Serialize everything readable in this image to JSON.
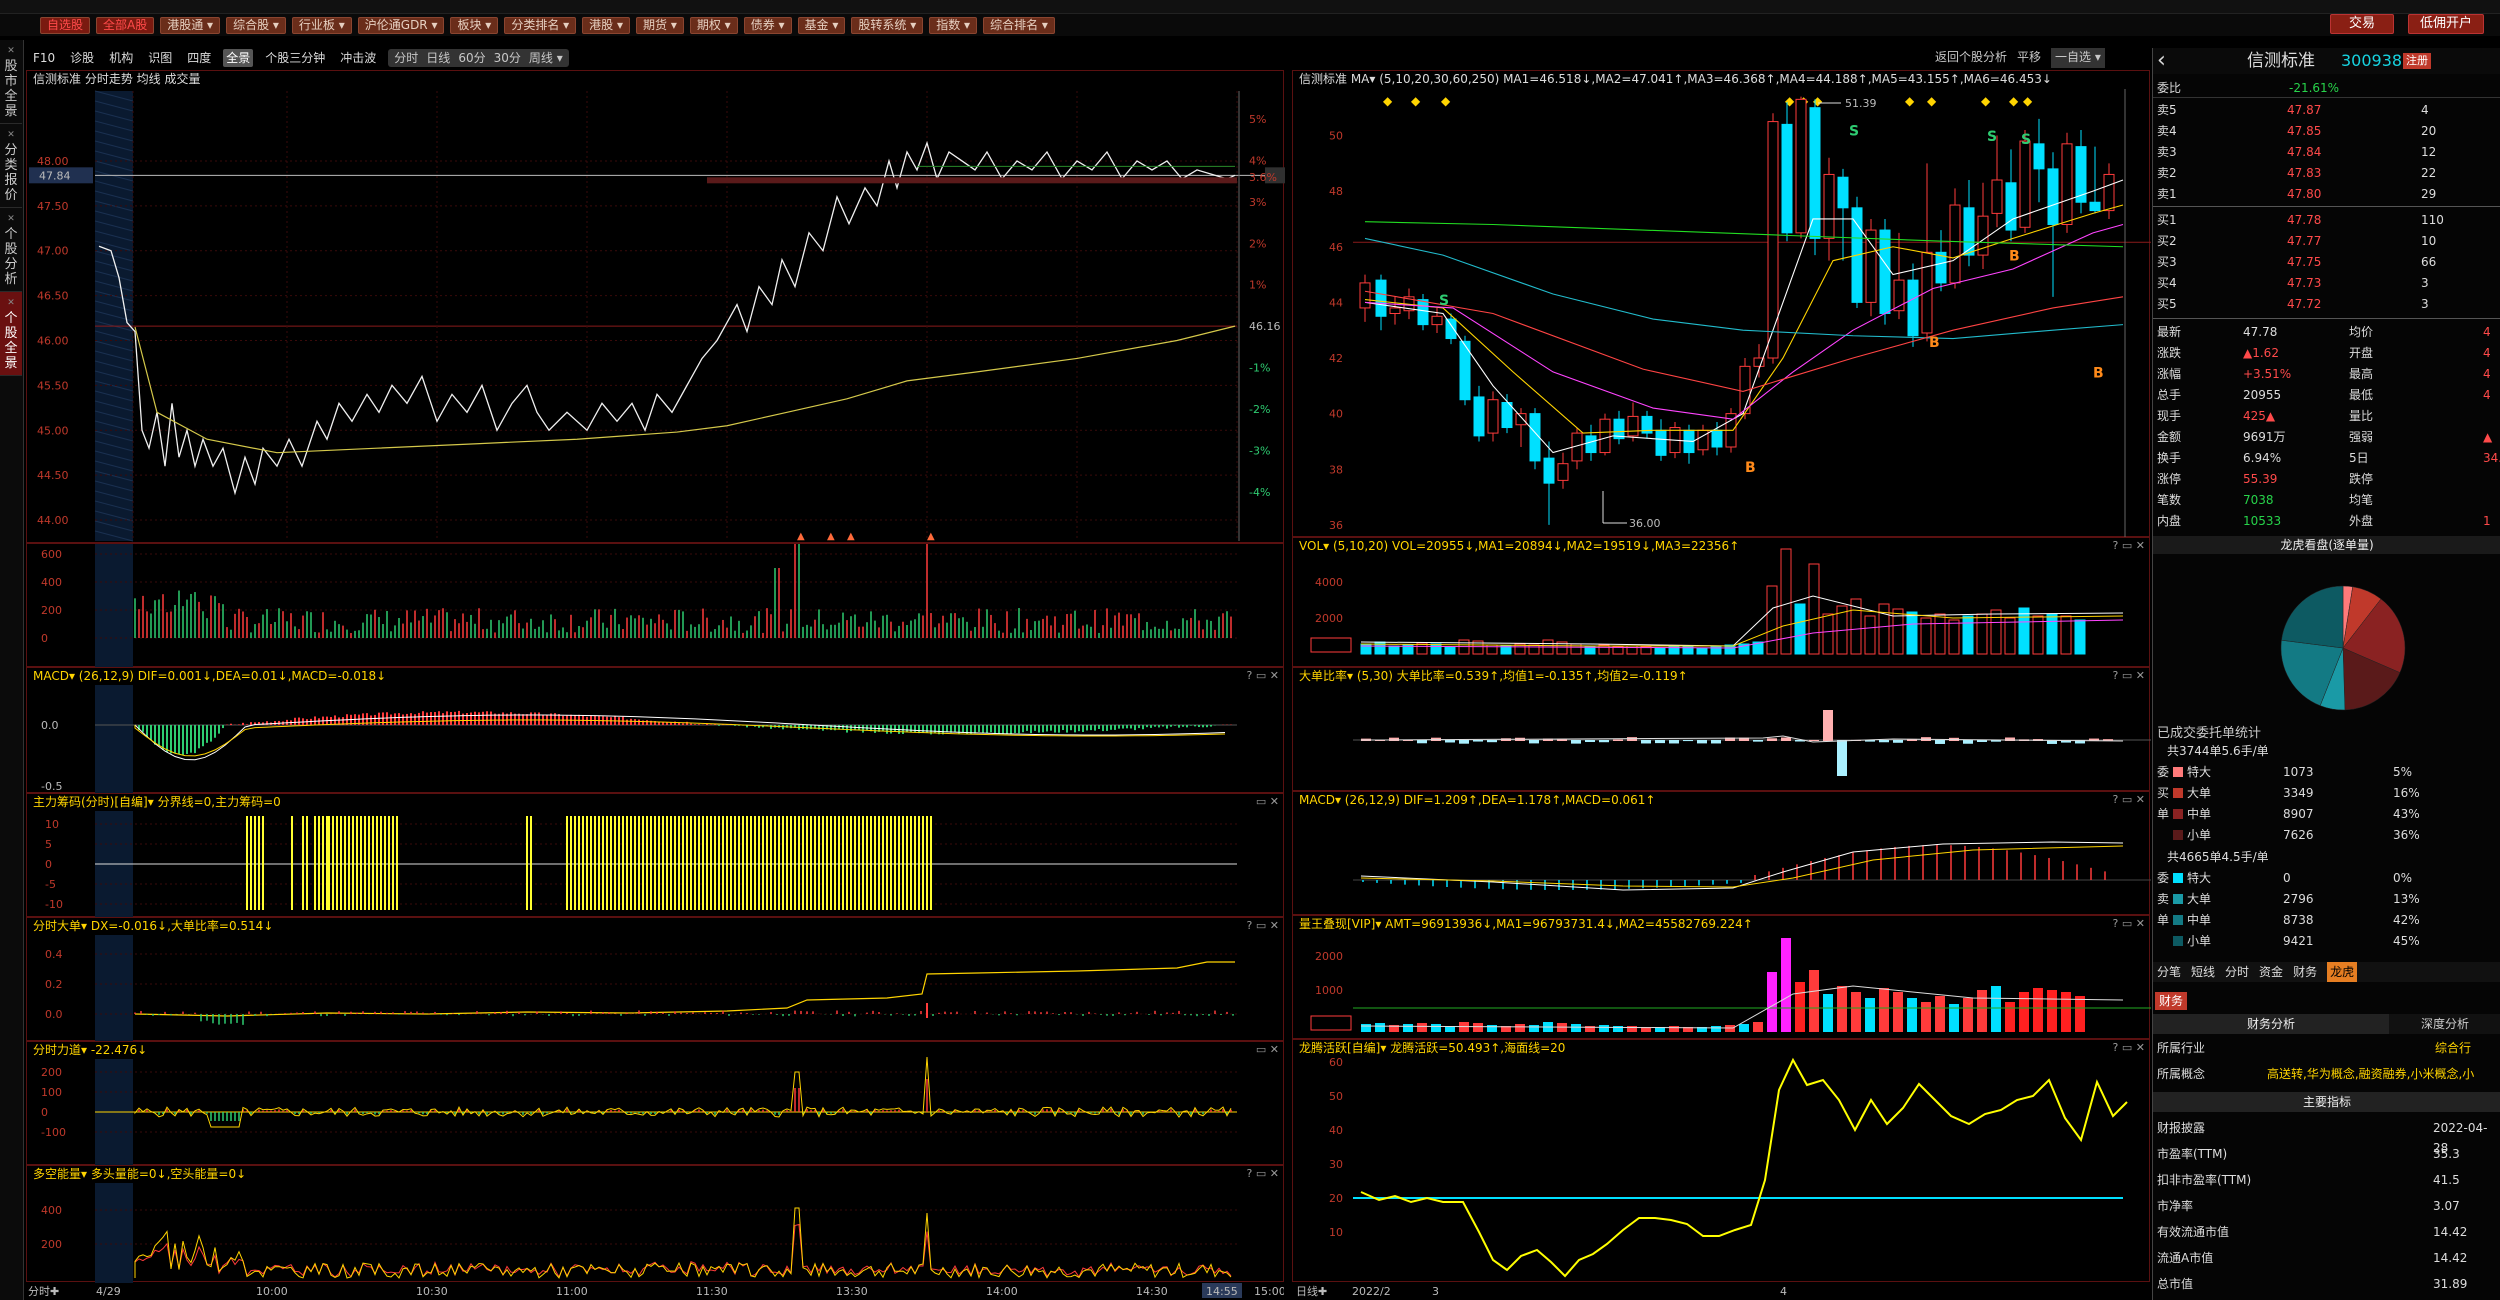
{
  "menu": [
    "自选股",
    "全部A股",
    "港股通",
    "综合股",
    "行业板",
    "沪伦通GDR",
    "板块",
    "分类排名",
    "港股",
    "期货",
    "期权",
    "债券",
    "基金",
    "股转系统",
    "指数",
    "综合排名"
  ],
  "top_buttons": {
    "trade": "交易",
    "open_account": "低佣开户"
  },
  "subtabs": [
    "F10",
    "诊股",
    "机构",
    "识图",
    "四度",
    "全景",
    "个股三分钟",
    "冲击波"
  ],
  "subtab_selected": "全景",
  "periods": [
    "分时",
    "日线",
    "60分",
    "30分",
    "周线"
  ],
  "left_tabs": [
    "股市全景",
    "分类报价",
    "个股分析",
    "个股全景"
  ],
  "intraday": {
    "header": "信测标准  分时走势 均线 成交量",
    "prices": [
      "48.00",
      "47.50",
      "47.00",
      "46.50",
      "46.00",
      "45.50",
      "45.00",
      "44.50",
      "44.00"
    ],
    "price_highlight": "47.84",
    "pcts": [
      "5%",
      "4%",
      "3.6%",
      "3%",
      "2%",
      "1%",
      "-1%",
      "-2%",
      "-3%",
      "-4%"
    ],
    "right_val": "46.16",
    "times": [
      "4/29",
      "10:00",
      "10:30",
      "11:00",
      "11:30",
      "13:30",
      "14:00",
      "14:30",
      "14:55",
      "15:00"
    ],
    "time_label": "分时",
    "vol_ticks": [
      "600",
      "400",
      "200",
      "0"
    ],
    "macd_header": "MACD▾  (26,12,9)  DIF=0.001↓,DEA=0.01↓,MACD=-0.018↓",
    "macd_ticks": [
      "0.0",
      "-0.5"
    ],
    "chip_header": "主力筹码(分时)[自编]▾  分界线=0,主力筹码=0",
    "chip_ticks": [
      "10",
      "5",
      "0",
      "-5",
      "-10"
    ],
    "big_header": "分时大单▾  DX=-0.016↓,大单比率=0.514↓",
    "big_ticks": [
      "0.4",
      "0.2",
      "0.0"
    ],
    "force_header": "分时力道▾  -22.476↓",
    "force_ticks": [
      "200",
      "100",
      "0",
      "-100"
    ],
    "energy_header": "多空能量▾  多头量能=0↓,空头能量=0↓",
    "energy_ticks": [
      "400",
      "200"
    ]
  },
  "daily": {
    "ctrl": [
      "返回个股分析",
      "平移",
      "一自选"
    ],
    "header": "信测标准  MA▾  (5,10,20,30,60,250)  MA1=46.518↓,MA2=47.041↑,MA3=46.368↑,MA4=44.188↑,MA5=43.155↑,MA6=46.453↓",
    "prices": [
      "50",
      "48",
      "46",
      "44",
      "42",
      "40",
      "38",
      "36"
    ],
    "hi_label": "51.39",
    "lo_label": "36.00",
    "dates": [
      "2022/2",
      "3",
      "4"
    ],
    "date_label": "日线",
    "vol_header": "VOL▾  (5,10,20)  VOL=20955↓,MA1=20894↓,MA2=19519↓,MA3=22356↑",
    "vol_ticks": [
      "4000",
      "2000"
    ],
    "bigratio_header": "大单比率▾  (5,30)  大单比率=0.539↑,均值1=-0.135↑,均值2=-0.119↑",
    "macd_header": "MACD▾  (26,12,9)  DIF=1.209↑,DEA=1.178↑,MACD=0.061↑",
    "amt_header": "量王叠现[VIP]▾  AMT=96913936↓,MA1=96793731.4↓,MA2=45582769.224↑",
    "amt_ticks": [
      "2000",
      "1000"
    ],
    "dragon_header": "龙腾活跃[自编]▾  龙腾活跃=50.493↑,海面线=20",
    "dragon_ticks": [
      "60",
      "50",
      "40",
      "30",
      "20",
      "10"
    ]
  },
  "quote": {
    "name": "信测标准",
    "code": "300938",
    "badge": "注册",
    "webi_label": "委比",
    "webi_val": "-21.61%",
    "asks": [
      [
        "卖5",
        "47.87",
        "4"
      ],
      [
        "卖4",
        "47.85",
        "20"
      ],
      [
        "卖3",
        "47.84",
        "12"
      ],
      [
        "卖2",
        "47.83",
        "22"
      ],
      [
        "卖1",
        "47.80",
        "29"
      ]
    ],
    "bids": [
      [
        "买1",
        "47.78",
        "110"
      ],
      [
        "买2",
        "47.77",
        "10"
      ],
      [
        "买3",
        "47.75",
        "66"
      ],
      [
        "买4",
        "47.73",
        "3"
      ],
      [
        "买5",
        "47.72",
        "3"
      ]
    ],
    "stats": [
      [
        "最新",
        "47.78",
        "均价",
        "4"
      ],
      [
        "涨跌",
        "▲1.62",
        "开盘",
        "4"
      ],
      [
        "涨幅",
        "+3.51%",
        "最高",
        "4"
      ],
      [
        "总手",
        "20955",
        "最低",
        "4"
      ],
      [
        "现手",
        "425▲",
        "量比",
        ""
      ],
      [
        "金额",
        "9691万",
        "强弱",
        "▲"
      ],
      [
        "换手",
        "6.94%",
        "5日",
        "34."
      ],
      [
        "涨停",
        "55.39",
        "跌停",
        ""
      ],
      [
        "笔数",
        "7038",
        "均笔",
        ""
      ],
      [
        "内盘",
        "10533",
        "外盘",
        "1"
      ]
    ],
    "pie_title": "龙虎看盘(逐单量)",
    "orders_title": "已成交委托单统计",
    "buy_summary": "共3744单5.6手/单",
    "buy_rows": [
      [
        "特大",
        "1073",
        "5%"
      ],
      [
        "大单",
        "3349",
        "16%"
      ],
      [
        "中单",
        "8907",
        "43%"
      ],
      [
        "小单",
        "7626",
        "36%"
      ]
    ],
    "sell_summary": "共4665单4.5手/单",
    "sell_rows": [
      [
        "特大",
        "0",
        "0%"
      ],
      [
        "大单",
        "2796",
        "13%"
      ],
      [
        "中单",
        "8738",
        "42%"
      ],
      [
        "小单",
        "9421",
        "45%"
      ]
    ],
    "side_buy": [
      "委",
      "买",
      "单"
    ],
    "side_sell": [
      "委",
      "卖",
      "单"
    ],
    "tabs": [
      "分笔",
      "短线",
      "分时",
      "资金",
      "财务",
      "龙虎"
    ],
    "tab_sel": "龙虎",
    "fin_tab": "财务",
    "fin_left": "财务分析",
    "fin_right": "深度分析",
    "industry_label": "所属行业",
    "industry_val": "综合行",
    "concept_label": "所属概念",
    "concept_val": "高送转,华为概念,融资融券,小米概念,小",
    "main_label": "主要指标",
    "fin_rows": [
      [
        "财报披露",
        "2022-04-28"
      ],
      [
        "市盈率(TTM)",
        "35.3"
      ],
      [
        "扣非市盈率(TTM)",
        "41.5"
      ],
      [
        "市净率",
        "3.07"
      ],
      [
        "有效流通市值",
        "14.42"
      ],
      [
        "流通A市值",
        "14.42"
      ],
      [
        "总市值",
        "31.89"
      ]
    ],
    "colors": {
      "up": "#ff3b3b",
      "down": "#00e0ff",
      "ma_yellow": "#ffd400"
    }
  }
}
